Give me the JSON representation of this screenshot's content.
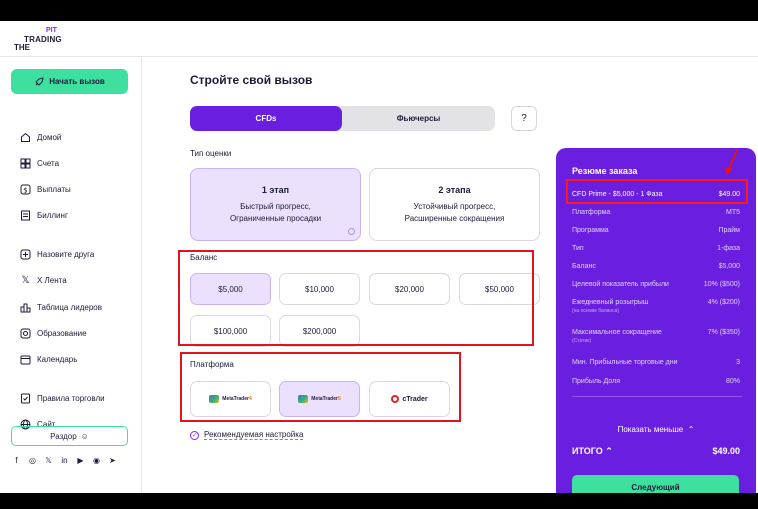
{
  "logo": {
    "line1": "PIT",
    "line2": "TRADING",
    "line3": "THE"
  },
  "sidebar": {
    "start_button": "Начать вызов",
    "items": [
      {
        "label": "Домой",
        "icon": "home-icon"
      },
      {
        "label": "Счета",
        "icon": "grid-icon"
      },
      {
        "label": "Выплаты",
        "icon": "dollar-icon"
      },
      {
        "label": "Биллинг",
        "icon": "receipt-icon"
      },
      {
        "label": "Назовите друга",
        "icon": "plus-circle-icon"
      },
      {
        "label": "X Лента",
        "icon": "x-icon"
      },
      {
        "label": "Таблица лидеров",
        "icon": "leaderboard-icon"
      },
      {
        "label": "Образование",
        "icon": "education-icon"
      },
      {
        "label": "Календарь",
        "icon": "calendar-icon"
      },
      {
        "label": "Правила торговли",
        "icon": "rules-icon"
      },
      {
        "label": "Сайт",
        "icon": "globe-icon"
      }
    ],
    "discord_button": "Раздор",
    "socials": [
      "facebook-icon",
      "instagram-icon",
      "x-icon",
      "linkedin-icon",
      "youtube-icon",
      "reddit-icon",
      "telegram-icon"
    ]
  },
  "main": {
    "title": "Стройте свой вызов",
    "tabs": [
      {
        "label": "CFDs",
        "active": true
      },
      {
        "label": "Фьючерсы",
        "active": false
      }
    ],
    "help_label": "?",
    "assessment_label": "Тип оценки",
    "stages": [
      {
        "title": "1 этап",
        "line1": "Быстрый прогресс,",
        "line2": "Ограниченные просадки",
        "selected": true
      },
      {
        "title": "2 этапа",
        "line1": "Устойчивый прогресс,",
        "line2": "Расширенные сокращения",
        "selected": false
      }
    ],
    "balance_label": "Баланс",
    "balances": [
      {
        "label": "$5,000",
        "selected": true
      },
      {
        "label": "$10,000",
        "selected": false
      },
      {
        "label": "$20,000",
        "selected": false
      },
      {
        "label": "$50,000",
        "selected": false
      },
      {
        "label": "$100,000",
        "selected": false
      },
      {
        "label": "$200,000",
        "selected": false
      }
    ],
    "platform_label": "Платформа",
    "platforms": [
      {
        "name": "MetaTrader",
        "version": "4",
        "selected": false
      },
      {
        "name": "MetaTrader",
        "version": "5",
        "selected": true
      },
      {
        "name": "cTrader",
        "selected": false
      }
    ],
    "recommended": "Рекомендуемая настройка"
  },
  "summary": {
    "title": "Резюме заказа",
    "header_row": {
      "label": "CFD Prime - $5,000 - 1 Фаза",
      "value": "$49.00"
    },
    "rows": [
      {
        "label": "Платформа",
        "value": "MT5"
      },
      {
        "label": "Программа",
        "value": "Прайм"
      },
      {
        "label": "Тип",
        "value": "1-фаза"
      },
      {
        "label": "Баланс",
        "value": "$5,000"
      },
      {
        "label": "Целевой показатель прибыли",
        "value": "10% ($500)"
      },
      {
        "label": "Ежедневный розыгрыш",
        "sub": "(на основе баланса)",
        "value": "4% ($200)"
      },
      {
        "label": "Максимальное сокращение",
        "sub": "(Статик)",
        "value": "7% ($350)"
      },
      {
        "label": "Мин. Прибыльные торговые дни",
        "value": "3"
      },
      {
        "label": "Прибыль Доля",
        "value": "80%"
      }
    ],
    "show_less": "Показать меньше",
    "total_label": "ИТОГО",
    "total_value": "$49.00",
    "next_button": "Следующий"
  },
  "colors": {
    "accent": "#6a1fe0",
    "green": "#3ee0a0",
    "highlight": "#e0141e",
    "selected_bg": "#ece0ff"
  }
}
